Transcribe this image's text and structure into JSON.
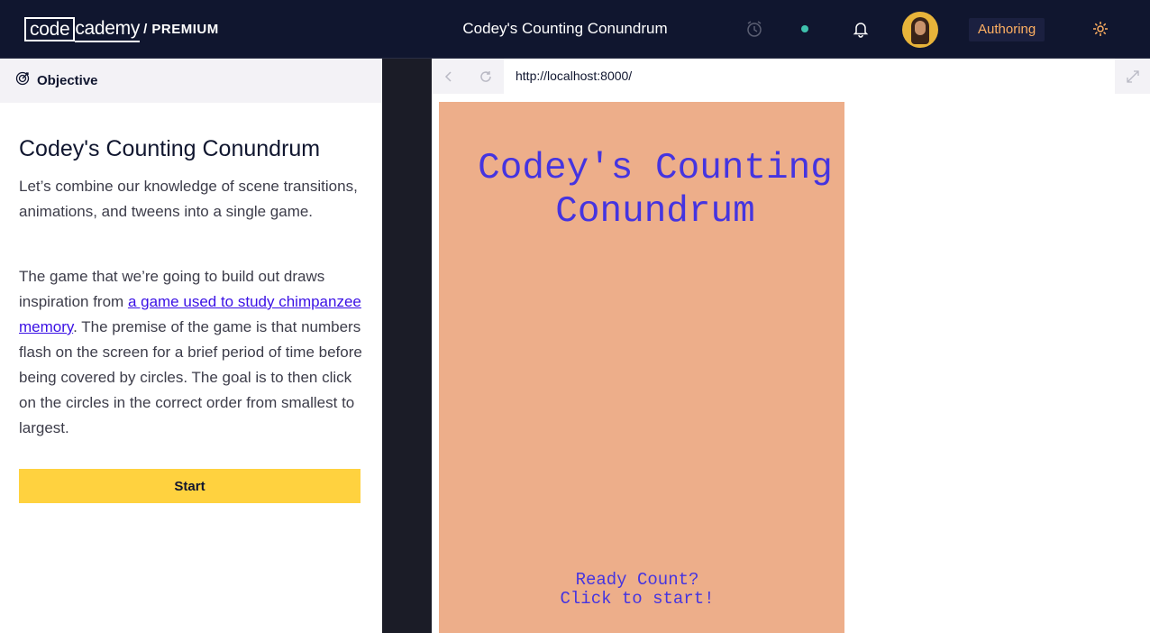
{
  "header": {
    "logo_code": "code",
    "logo_cademy": "cademy",
    "logo_premium": "/ PREMIUM",
    "title": "Codey's Counting Conundrum",
    "authoring_label": "Authoring"
  },
  "objective": {
    "label": "Objective",
    "lesson_title": "Codey's Counting Conundrum",
    "para1": "Let’s combine our knowledge of scene transitions, animations, and tweens into a single game.",
    "para2_before": "The game that we’re going to build out draws inspiration from ",
    "para2_link": "a game used to study chimpanzee memory",
    "para2_after": ". The premise of the game is that numbers flash on the screen for a brief period of time before being covered by circles. The goal is to then click on the circles in the correct order from smallest to largest.",
    "start_label": "Start"
  },
  "browser": {
    "url": "http://localhost:8000/",
    "game_title": "Codey's Counting Conundrum",
    "game_prompt": "Ready Count?\nClick to start!"
  },
  "colors": {
    "topbar_bg": "#10162f",
    "start_button": "#ffd23f",
    "game_bg": "#edae8a",
    "game_text": "#4534e0",
    "link": "#3a10e5",
    "authoring_text": "#ffb062"
  },
  "icons": [
    "alarm-clock-icon",
    "status-dot-icon",
    "bell-icon",
    "gear-icon",
    "objective-target-icon",
    "back-arrow-icon",
    "refresh-icon",
    "expand-icon"
  ]
}
